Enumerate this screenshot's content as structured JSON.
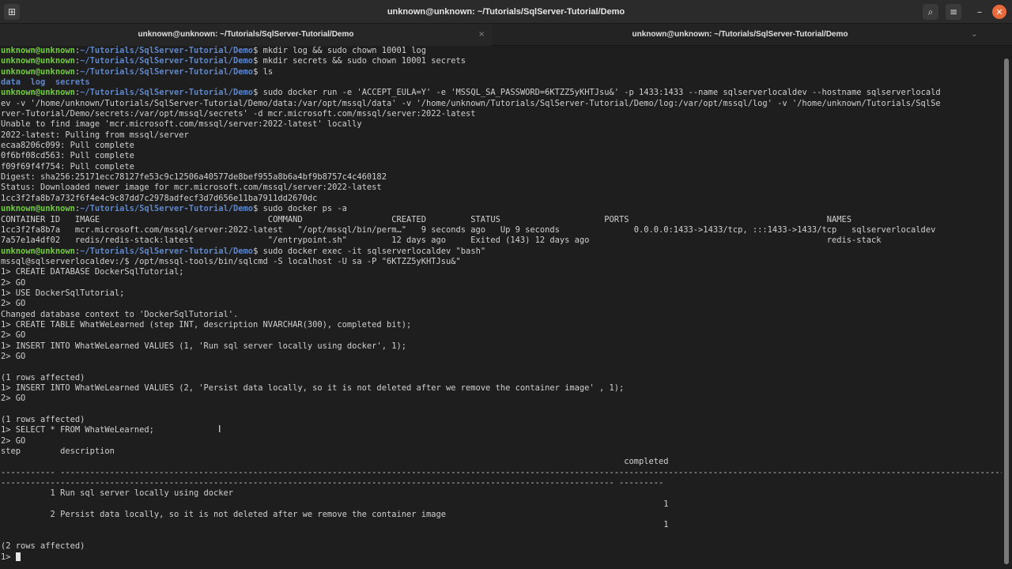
{
  "window": {
    "title": "unknown@unknown: ~/Tutorials/SqlServer-Tutorial/Demo",
    "icons": [
      "new-tab-icon",
      "search-icon",
      "menu-icon",
      "minimize-icon",
      "close-icon"
    ],
    "glyphs": {
      "new_tab": "⊞",
      "search": "⌕",
      "menu": "≡",
      "minimize": "–",
      "close": "✕"
    }
  },
  "tabs": [
    {
      "label": "unknown@unknown: ~/Tutorials/SqlServer-Tutorial/Demo",
      "close": "×"
    },
    {
      "label": "unknown@unknown: ~/Tutorials/SqlServer-Tutorial/Demo",
      "close": "⌄"
    }
  ],
  "prompt": {
    "user": "unknown@unknown",
    "sep": ":",
    "path": "~/Tutorials/SqlServer-Tutorial/Demo",
    "suffix": "$ "
  },
  "colors": {
    "background": "#1e1e1e",
    "prompt_user": "#6fcf3a",
    "prompt_path": "#5e86c9",
    "text": "#d0d0d0",
    "close_button": "#e8693a"
  },
  "terminal": {
    "lines": [
      {
        "type": "cmd",
        "text": "mkdir log && sudo chown 10001 log"
      },
      {
        "type": "cmd",
        "text": "mkdir secrets && sudo chown 10001 secrets"
      },
      {
        "type": "cmd",
        "text": "ls"
      },
      {
        "type": "dirs",
        "text": "data  log  secrets"
      },
      {
        "type": "cmd",
        "text": "sudo docker run -e 'ACCEPT_EULA=Y' -e 'MSSQL_SA_PASSWORD=6KTZZ5yKHTJsu&' -p 1433:1433 --name sqlserverlocaldev --hostname sqlserverlocald"
      },
      {
        "type": "out",
        "text": "ev -v '/home/unknown/Tutorials/SqlServer-Tutorial/Demo/data:/var/opt/mssql/data' -v '/home/unknown/Tutorials/SqlServer-Tutorial/Demo/log:/var/opt/mssql/log' -v '/home/unknown/Tutorials/SqlSe"
      },
      {
        "type": "out",
        "text": "rver-Tutorial/Demo/secrets:/var/opt/mssql/secrets' -d mcr.microsoft.com/mssql/server:2022-latest"
      },
      {
        "type": "out",
        "text": "Unable to find image 'mcr.microsoft.com/mssql/server:2022-latest' locally"
      },
      {
        "type": "out",
        "text": "2022-latest: Pulling from mssql/server"
      },
      {
        "type": "out",
        "text": "ecaa8206c099: Pull complete"
      },
      {
        "type": "out",
        "text": "0f6bf08cd563: Pull complete"
      },
      {
        "type": "out",
        "text": "f09f69f4f754: Pull complete"
      },
      {
        "type": "out",
        "text": "Digest: sha256:25171ecc78127fe53c9c12506a40577de8bef955a8b6a4bf9b8757c4c460182"
      },
      {
        "type": "out",
        "text": "Status: Downloaded newer image for mcr.microsoft.com/mssql/server:2022-latest"
      },
      {
        "type": "out",
        "text": "1cc3f2fa8b7a732f6f4e4c9c87dd7c2978adfecf3d7d656e11ba7911dd2670dc"
      },
      {
        "type": "cmd",
        "text": "sudo docker ps -a"
      },
      {
        "type": "out",
        "text": "CONTAINER ID   IMAGE                                  COMMAND                  CREATED         STATUS                     PORTS                                        NAMES"
      },
      {
        "type": "out",
        "text": "1cc3f2fa8b7a   mcr.microsoft.com/mssql/server:2022-latest   \"/opt/mssql/bin/perm…\"   9 seconds ago   Up 9 seconds               0.0.0.0:1433->1433/tcp, :::1433->1433/tcp   sqlserverlocaldev"
      },
      {
        "type": "out",
        "text": "7a57e1a4df02   redis/redis-stack:latest               \"/entrypoint.sh\"         12 days ago     Exited (143) 12 days ago                                                redis-stack"
      },
      {
        "type": "cmd",
        "text": "sudo docker exec -it sqlserverlocaldev \"bash\""
      },
      {
        "type": "out",
        "text": "mssql@sqlserverlocaldev:/$ /opt/mssql-tools/bin/sqlcmd -S localhost -U sa -P \"6KTZZ5yKHTJsu&\""
      },
      {
        "type": "out",
        "text": "1> CREATE DATABASE DockerSqlTutorial;"
      },
      {
        "type": "out",
        "text": "2> GO"
      },
      {
        "type": "out",
        "text": "1> USE DockerSqlTutorial;"
      },
      {
        "type": "out",
        "text": "2> GO"
      },
      {
        "type": "out",
        "text": "Changed database context to 'DockerSqlTutorial'."
      },
      {
        "type": "out",
        "text": "1> CREATE TABLE WhatWeLearned (step INT, description NVARCHAR(300), completed bit);"
      },
      {
        "type": "out",
        "text": "2> GO"
      },
      {
        "type": "out",
        "text": "1> INSERT INTO WhatWeLearned VALUES (1, 'Run sql server locally using docker', 1);"
      },
      {
        "type": "out",
        "text": "2> GO"
      },
      {
        "type": "out",
        "text": ""
      },
      {
        "type": "out",
        "text": "(1 rows affected)"
      },
      {
        "type": "out",
        "text": "1> INSERT INTO WhatWeLearned VALUES (2, 'Persist data locally, so it is not deleted after we remove the container image' , 1);"
      },
      {
        "type": "out",
        "text": "2> GO"
      },
      {
        "type": "out",
        "text": ""
      },
      {
        "type": "out",
        "text": "(1 rows affected)"
      },
      {
        "type": "out",
        "text": "1> SELECT * FROM WhatWeLearned;"
      },
      {
        "type": "out",
        "text": "2> GO"
      },
      {
        "type": "out",
        "text": "step        description"
      },
      {
        "type": "out",
        "text": "                                                                                                                              completed"
      },
      {
        "type": "out",
        "text": "----------- ----------------------------------------------------------------------------------------------------------------------------------------------------------------------------------------------------------"
      },
      {
        "type": "out",
        "text": "---------------------------------------------------------------------------------------------------------------------------- ---------"
      },
      {
        "type": "out",
        "text": "          1 Run sql server locally using docker"
      },
      {
        "type": "out",
        "text": "                                                                                                                                      1"
      },
      {
        "type": "out",
        "text": "          2 Persist data locally, so it is not deleted after we remove the container image"
      },
      {
        "type": "out",
        "text": "                                                                                                                                      1"
      },
      {
        "type": "out",
        "text": ""
      },
      {
        "type": "out",
        "text": "(2 rows affected)"
      },
      {
        "type": "cursor",
        "text": "1> "
      }
    ]
  }
}
